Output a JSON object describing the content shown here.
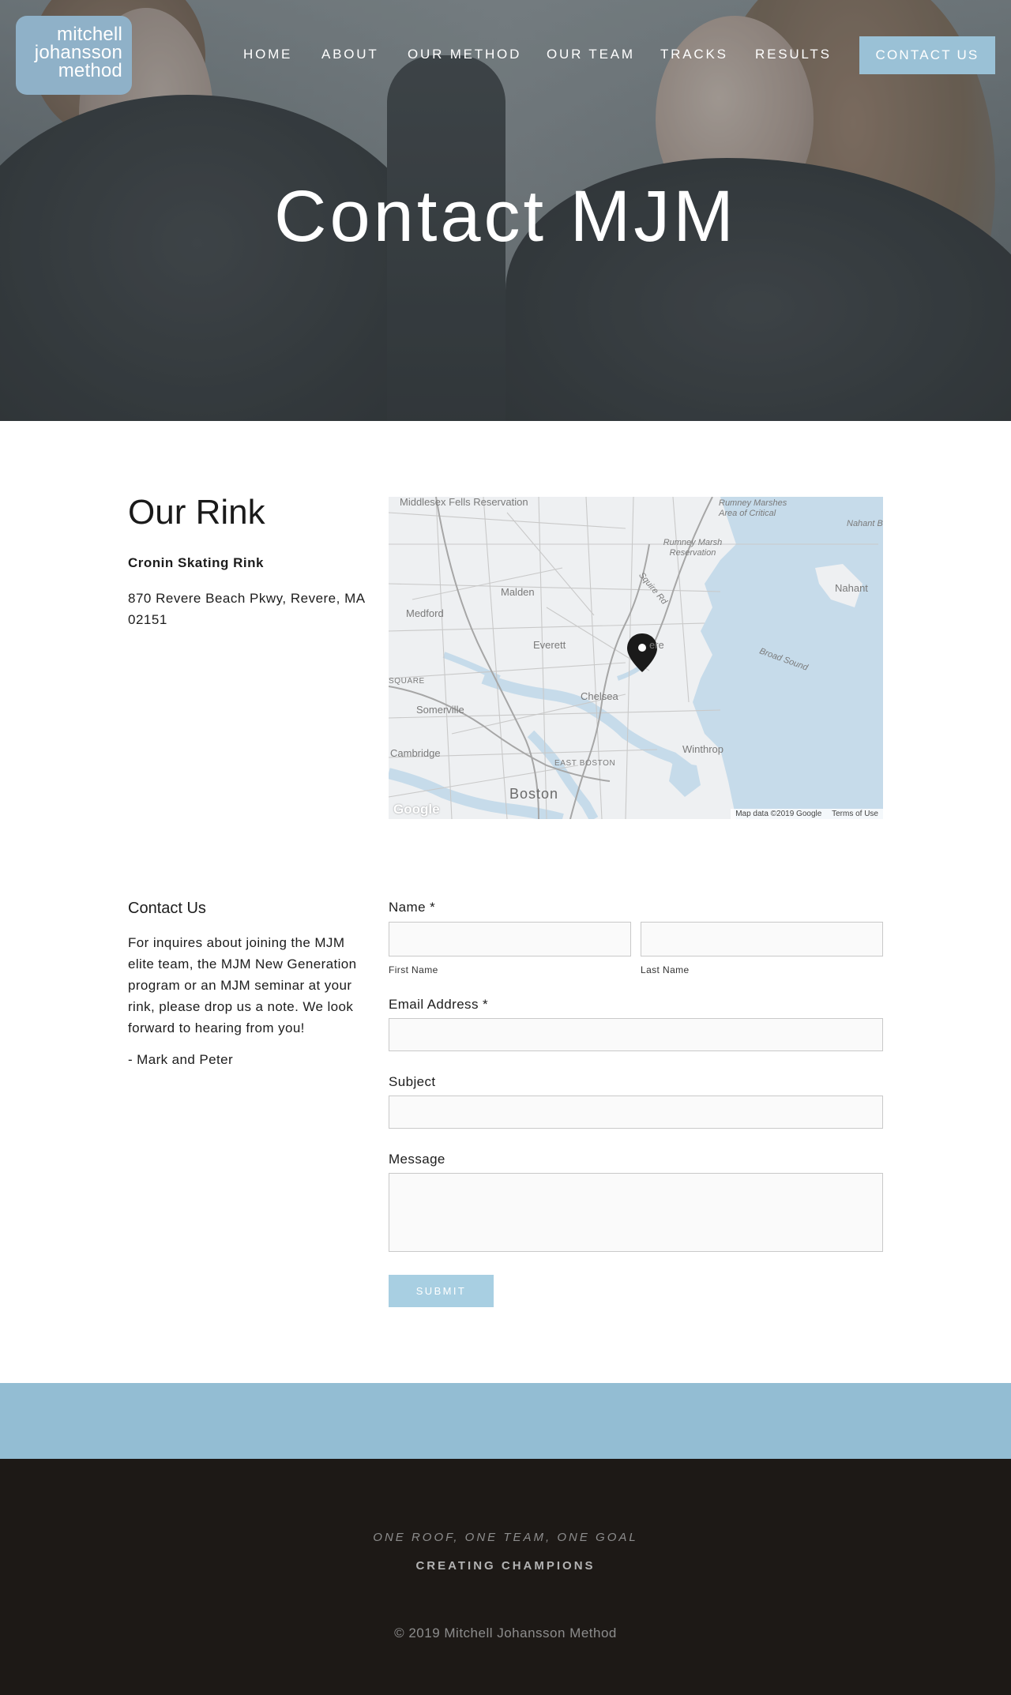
{
  "logo": {
    "line1": "mitchell",
    "line2": "johansson",
    "line3": "method"
  },
  "nav": {
    "items": [
      "HOME",
      "ABOUT",
      "OUR METHOD",
      "OUR TEAM",
      "TRACKS",
      "RESULTS"
    ],
    "contact_button": "CONTACT US"
  },
  "hero": {
    "title": "Contact MJM"
  },
  "rink": {
    "title": "Our Rink",
    "name": "Cronin Skating Rink",
    "address": "870 Revere Beach Pkwy, Revere, MA 02151"
  },
  "map": {
    "labels": {
      "middlesex": "Middlesex Fells Reservation",
      "rumney_marshes_area": "Rumney Marshes Area of Critical",
      "rumney_marsh": "Rumney Marsh Reservation",
      "nahant_bay": "Nahant B",
      "nahant": "Nahant",
      "malden": "Malden",
      "medford": "Medford",
      "everett": "Everett",
      "revere": "ere",
      "squire_rd": "Squire Rd",
      "broad_sound": "Broad Sound",
      "square": "SQUARE",
      "chelsea": "Chelsea",
      "somerville": "Somerville",
      "winthrop": "Winthrop",
      "cambridge": "Cambridge",
      "east_boston": "EAST BOSTON",
      "boston": "Boston"
    },
    "google": "Google",
    "credit": "Map data ©2019 Google",
    "terms": "Terms of Use"
  },
  "contact": {
    "heading": "Contact Us",
    "text": "For inquires about joining the MJM elite team, the MJM New Generation program or an MJM seminar at your rink, please drop us a note. We look forward to hearing from you!",
    "signature": "- Mark and Peter"
  },
  "form": {
    "name_label": "Name *",
    "first_name_sub": "First Name",
    "last_name_sub": "Last Name",
    "email_label": "Email Address *",
    "subject_label": "Subject",
    "message_label": "Message",
    "submit_label": "SUBMIT"
  },
  "footer": {
    "tagline": "ONE ROOF, ONE TEAM, ONE GOAL",
    "subtagline": "CREATING CHAMPIONS",
    "copyright": "© 2019 Mitchell Johansson Method"
  },
  "colors": {
    "accent": "#9ac1d6",
    "band": "#93bdd3",
    "footer_bg": "#1d1916",
    "submit": "#a8cfe2"
  }
}
